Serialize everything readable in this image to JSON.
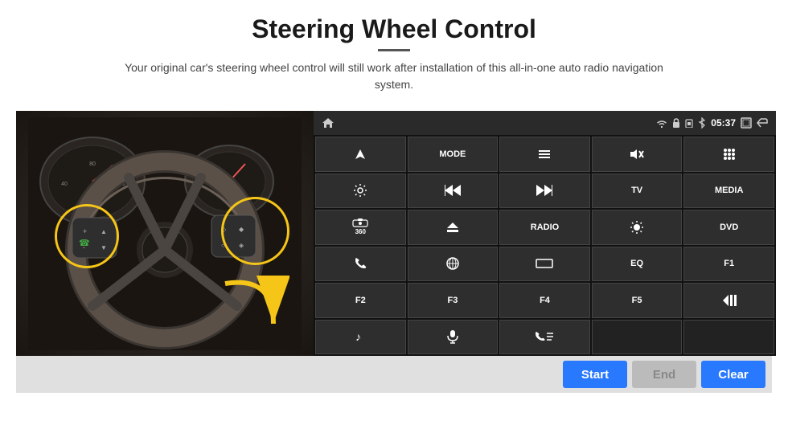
{
  "page": {
    "title": "Steering Wheel Control",
    "subtitle": "Your original car's steering wheel control will still work after installation of this all-in-one auto radio navigation system."
  },
  "status_bar": {
    "time": "05:37",
    "icons": [
      "home",
      "wifi",
      "lock",
      "sim",
      "bluetooth",
      "fullscreen",
      "back"
    ]
  },
  "grid_buttons": [
    {
      "id": "nav",
      "type": "icon",
      "icon": "▲",
      "label": ""
    },
    {
      "id": "mode",
      "type": "text",
      "label": "MODE"
    },
    {
      "id": "menu",
      "type": "icon",
      "icon": "☰",
      "label": ""
    },
    {
      "id": "mute",
      "type": "icon",
      "icon": "🔇",
      "label": ""
    },
    {
      "id": "apps",
      "type": "icon",
      "icon": "⠿",
      "label": ""
    },
    {
      "id": "settings",
      "type": "icon",
      "icon": "⚙",
      "label": ""
    },
    {
      "id": "prev",
      "type": "icon",
      "icon": "⏮",
      "label": ""
    },
    {
      "id": "next",
      "type": "icon",
      "icon": "⏭",
      "label": ""
    },
    {
      "id": "tv",
      "type": "text",
      "label": "TV"
    },
    {
      "id": "media",
      "type": "text",
      "label": "MEDIA"
    },
    {
      "id": "360cam",
      "type": "icon",
      "icon": "📷",
      "label": "360"
    },
    {
      "id": "eject",
      "type": "icon",
      "icon": "⏏",
      "label": ""
    },
    {
      "id": "radio",
      "type": "text",
      "label": "RADIO"
    },
    {
      "id": "brightness",
      "type": "icon",
      "icon": "☀",
      "label": ""
    },
    {
      "id": "dvd",
      "type": "text",
      "label": "DVD"
    },
    {
      "id": "phone",
      "type": "icon",
      "icon": "📞",
      "label": ""
    },
    {
      "id": "browse",
      "type": "icon",
      "icon": "🌀",
      "label": ""
    },
    {
      "id": "screen",
      "type": "icon",
      "icon": "▬",
      "label": ""
    },
    {
      "id": "eq",
      "type": "text",
      "label": "EQ"
    },
    {
      "id": "f1",
      "type": "text",
      "label": "F1"
    },
    {
      "id": "f2",
      "type": "text",
      "label": "F2"
    },
    {
      "id": "f3",
      "type": "text",
      "label": "F3"
    },
    {
      "id": "f4",
      "type": "text",
      "label": "F4"
    },
    {
      "id": "f5",
      "type": "text",
      "label": "F5"
    },
    {
      "id": "playpause",
      "type": "icon",
      "icon": "⏯",
      "label": ""
    },
    {
      "id": "music",
      "type": "icon",
      "icon": "♪",
      "label": ""
    },
    {
      "id": "mic",
      "type": "icon",
      "icon": "🎤",
      "label": ""
    },
    {
      "id": "phonecall",
      "type": "icon",
      "icon": "📲",
      "label": ""
    },
    {
      "id": "empty1",
      "type": "empty",
      "label": ""
    },
    {
      "id": "empty2",
      "type": "empty",
      "label": ""
    }
  ],
  "bottom_bar": {
    "start_label": "Start",
    "end_label": "End",
    "clear_label": "Clear"
  },
  "colors": {
    "accent": "#2979ff",
    "panel_bg": "#1c1c1c",
    "button_bg": "#2e2e2e",
    "disabled": "#bbb"
  }
}
